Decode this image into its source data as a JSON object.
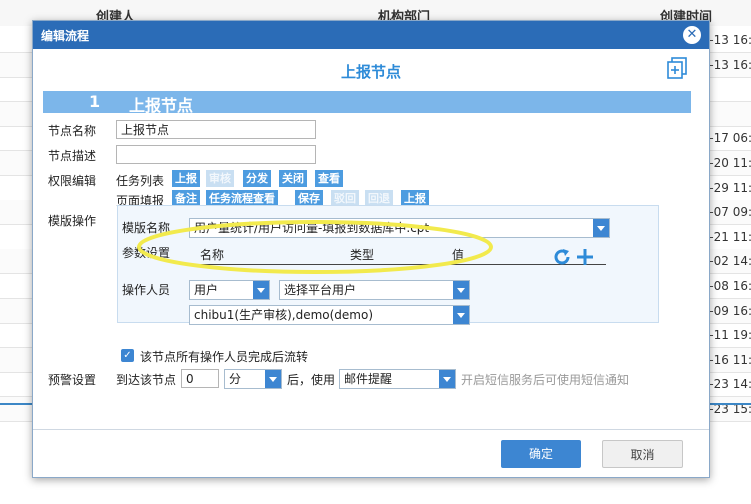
{
  "background": {
    "headers": [
      "创建人",
      "机构部门",
      "创建时间"
    ],
    "times": [
      "1–13 16:2",
      "1–13 16:2",
      "",
      "",
      "1–17 06:",
      "1–20 11:1",
      "1–29 11:4",
      "2–07 09:",
      "2–21 11:",
      "1–02 14:2",
      "1–08 16:4",
      "1–09 16:5",
      "1–11 19:",
      "1–16 11:0",
      "1–23 14:1",
      "1–23 15:3"
    ]
  },
  "dialog": {
    "title": "编辑流程",
    "close_icon": "close-circle-icon",
    "heading": "上报节点",
    "section": {
      "number": "1",
      "name": "上报节点"
    },
    "node_name": {
      "label": "节点名称",
      "value": "上报节点"
    },
    "node_desc": {
      "label": "节点描述",
      "value": ""
    },
    "perm": {
      "label": "权限编辑",
      "task_list_label": "任务列表",
      "page_fill_label": "页面填报",
      "task_buttons": [
        {
          "text": "上报",
          "enabled": true
        },
        {
          "text": "审核",
          "enabled": false
        },
        {
          "text": "分发",
          "enabled": true
        },
        {
          "text": "关闭",
          "enabled": true
        },
        {
          "text": "查看",
          "enabled": true
        }
      ],
      "page_buttons": [
        {
          "text": "备注",
          "enabled": true
        },
        {
          "text": "任务流程查看",
          "enabled": true
        },
        {
          "text": "保存",
          "enabled": true
        },
        {
          "text": "驳回",
          "enabled": false
        },
        {
          "text": "回退",
          "enabled": false
        },
        {
          "text": "上报",
          "enabled": true
        }
      ]
    },
    "template": {
      "label": "模版操作",
      "name_label": "模版名称",
      "name_value": "用户量统计/用户访问量-填报到数据库中.cpt",
      "params_label": "参数设置",
      "params_headers": [
        "名称",
        "类型",
        "值"
      ],
      "operator_label": "操作人员",
      "operator_type": "用户",
      "operator_select": "选择平台用户",
      "operator_value": "chibu1(生产审核),demo(demo)"
    },
    "checkbox_label": "该节点所有操作人员完成后流转",
    "warning": {
      "label": "预警设置",
      "arrive_label": "到达该节点",
      "value": "0",
      "unit": "分",
      "after_label": "后，使用",
      "method": "邮件提醒",
      "note": "开启短信服务后可使用短信通知"
    },
    "ok_label": "确定",
    "cancel_label": "取消"
  },
  "colors": {
    "title_bar": "#2b6cb7",
    "accent": "#3d86d2",
    "section_bar": "#7cb6ea",
    "highlight": "#f2ea4d"
  }
}
